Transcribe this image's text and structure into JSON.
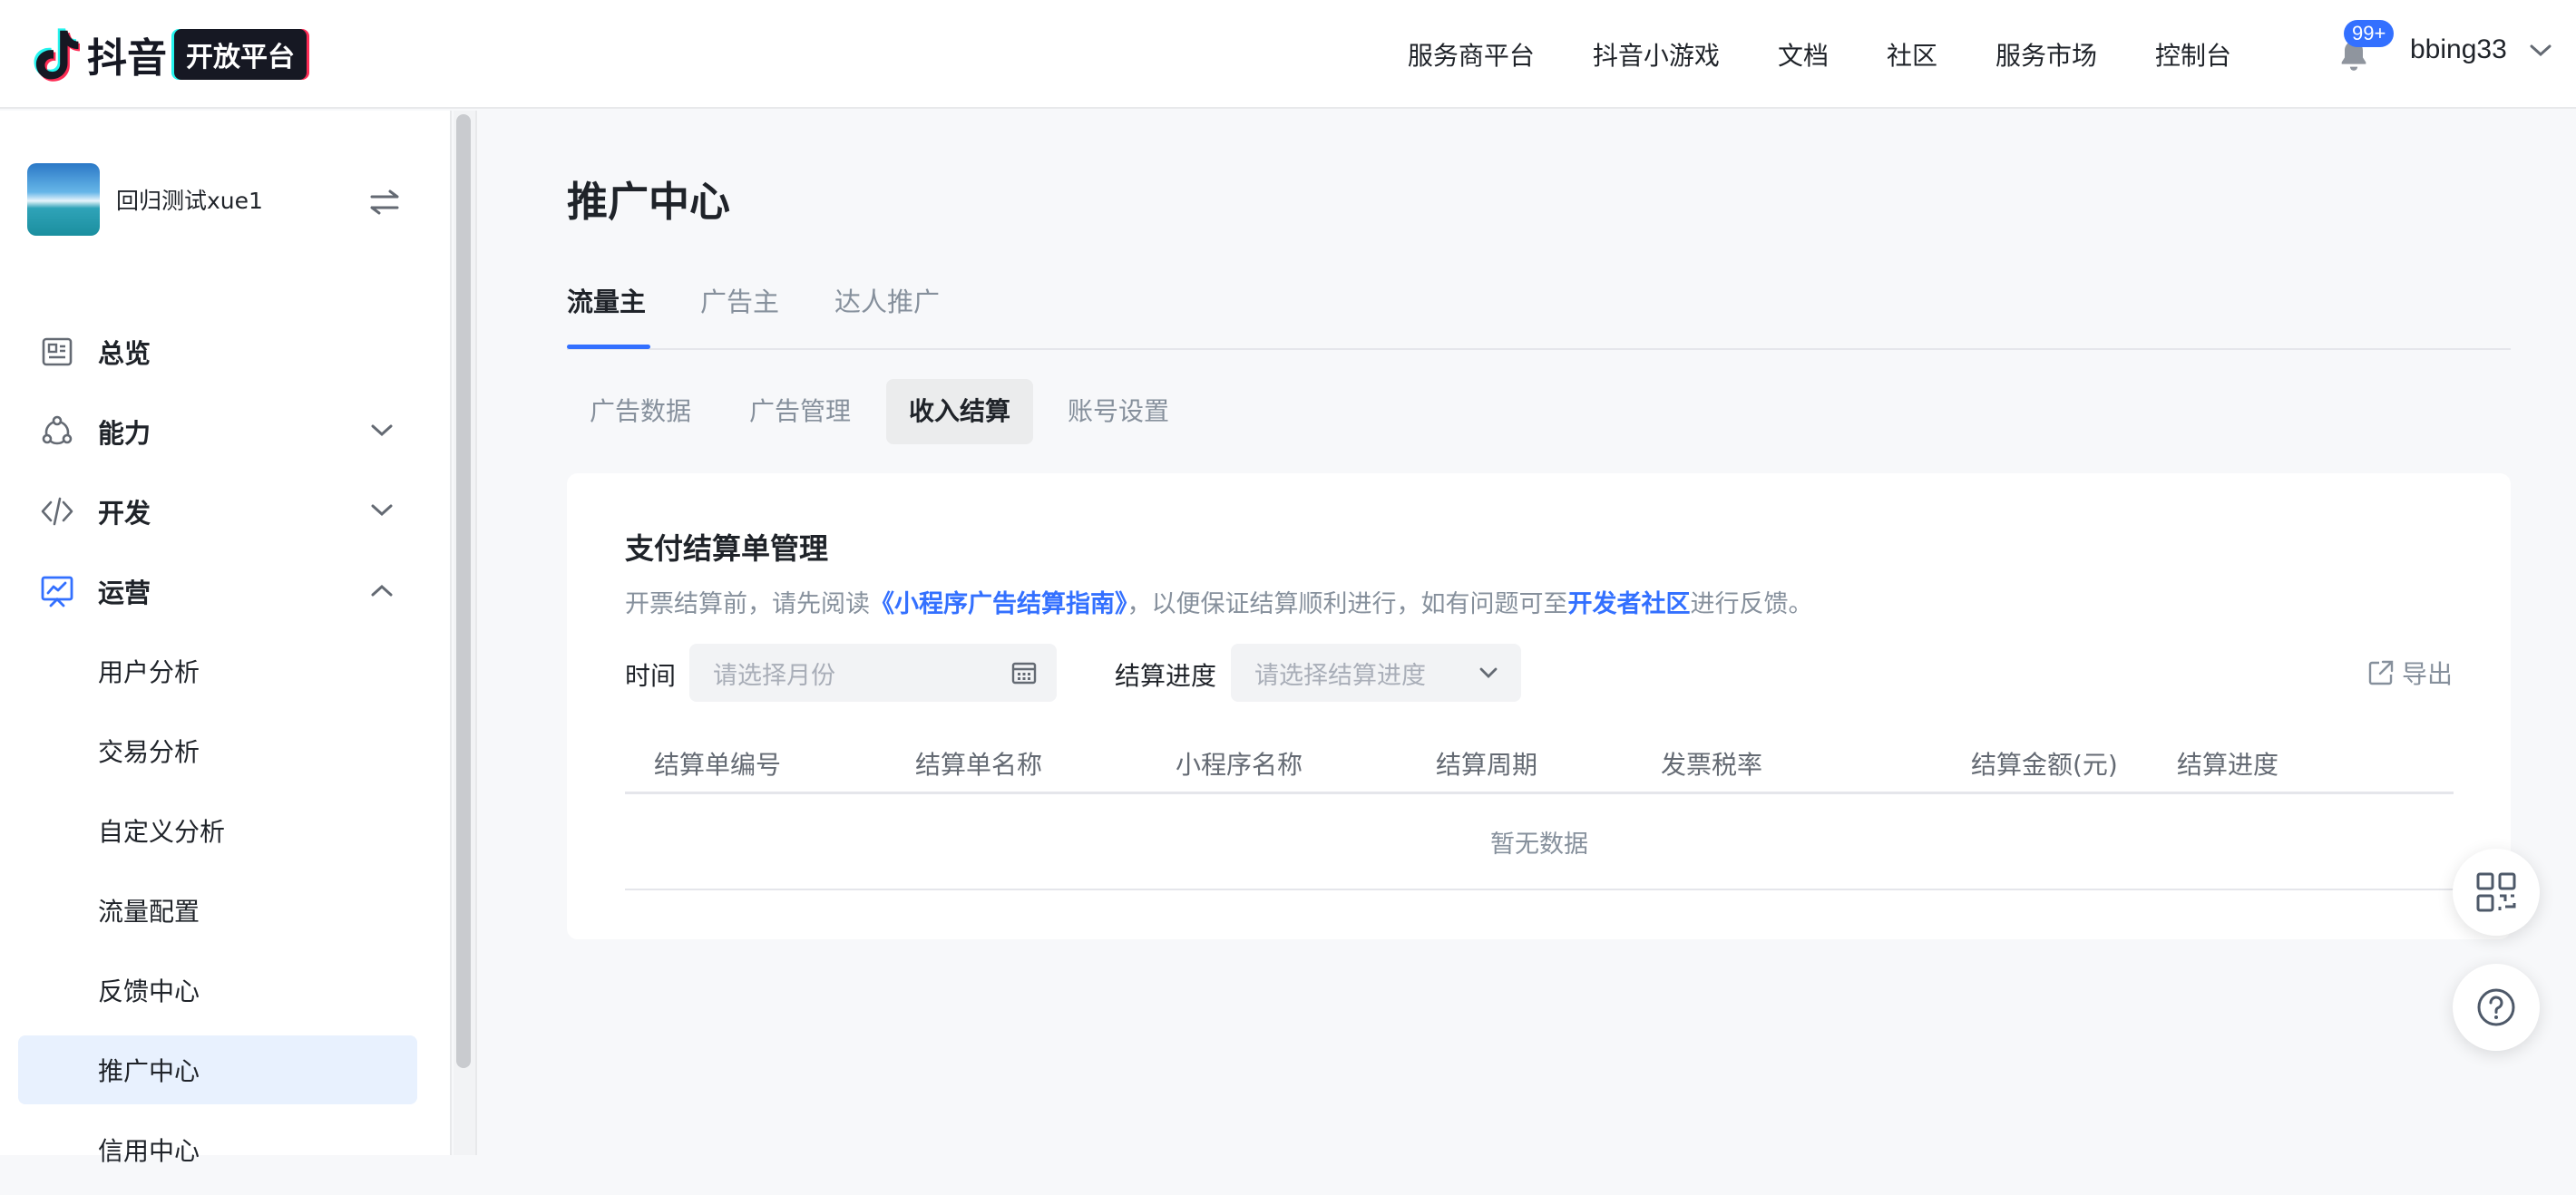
{
  "header": {
    "logo_text": "抖音",
    "logo_badge": "开放平台",
    "nav": [
      "服务商平台",
      "抖音小游戏",
      "文档",
      "社区",
      "服务市场",
      "控制台"
    ],
    "notification_count": "99+",
    "username": "bbing33"
  },
  "sidebar": {
    "app_name": "回归测试xue1",
    "menu": [
      {
        "label": "总览",
        "icon": "overview-icon"
      },
      {
        "label": "能力",
        "icon": "capability-icon",
        "expanded": false
      },
      {
        "label": "开发",
        "icon": "code-icon",
        "expanded": false
      },
      {
        "label": "运营",
        "icon": "operation-icon",
        "expanded": true
      }
    ],
    "sub_items": [
      "用户分析",
      "交易分析",
      "自定义分析",
      "流量配置",
      "反馈中心",
      "推广中心",
      "信用中心"
    ],
    "active_sub_item": "推广中心"
  },
  "main": {
    "page_title": "推广中心",
    "tabs": [
      "流量主",
      "广告主",
      "达人推广"
    ],
    "active_tab": "流量主",
    "sub_tabs": [
      "广告数据",
      "广告管理",
      "收入结算",
      "账号设置"
    ],
    "active_sub_tab": "收入结算",
    "card": {
      "title": "支付结算单管理",
      "desc_prefix": "开票结算前，请先阅读",
      "desc_link1": "《小程序广告结算指南》",
      "desc_middle": "，以便保证结算顺利进行，如有问题可至",
      "desc_link2": "开发者社区",
      "desc_suffix": "进行反馈。",
      "time_label": "时间",
      "time_placeholder": "请选择月份",
      "progress_label": "结算进度",
      "progress_placeholder": "请选择结算进度",
      "export_label": "导出",
      "columns": [
        "结算单编号",
        "结算单名称",
        "小程序名称",
        "结算周期",
        "发票税率",
        "结算金额(元)",
        "结算进度"
      ],
      "empty_text": "暂无数据"
    }
  },
  "colors": {
    "accent": "#3370ff",
    "active_bg": "#e8f1fe",
    "text_primary": "#1f2329",
    "text_secondary": "#86909c"
  }
}
